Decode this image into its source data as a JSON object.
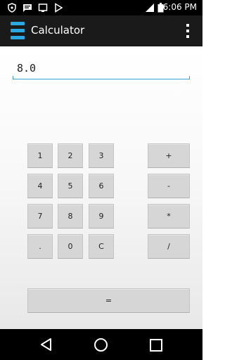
{
  "status_bar": {
    "time": "6:06 PM",
    "icons": [
      "shield-icon",
      "message-icon",
      "cast-icon",
      "play-store-icon",
      "signal-icon",
      "battery-icon"
    ]
  },
  "app_bar": {
    "title": "Calculator",
    "app_icon": "calculator-app-icon",
    "menu_icon": "overflow-menu-icon"
  },
  "display": {
    "value": "8.0"
  },
  "keypad": {
    "digits": [
      [
        "1",
        "2",
        "3"
      ],
      [
        "4",
        "5",
        "6"
      ],
      [
        "7",
        "8",
        "9"
      ],
      [
        ".",
        "0",
        "C"
      ]
    ],
    "operators": [
      "+",
      "-",
      "*",
      "/"
    ],
    "equals": "="
  },
  "nav_bar": {
    "icons": [
      "back-icon",
      "home-icon",
      "recents-icon"
    ]
  },
  "colors": {
    "accent": "#29a9e0",
    "app_bar": "#1a1a1a",
    "button": "#d6d6d6"
  }
}
